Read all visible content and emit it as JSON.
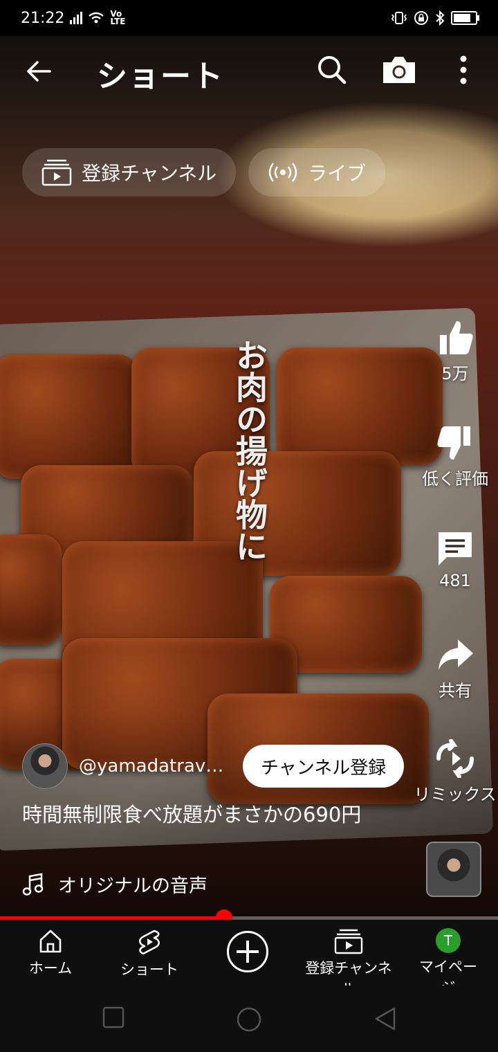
{
  "status_bar": {
    "time": "21:22",
    "network_badge_top": "Vo",
    "network_badge_bottom": "LTE",
    "icons": [
      "signal-icon",
      "wifi-icon",
      "vibrate-icon",
      "lock-rotation-icon",
      "bluetooth-icon",
      "battery-icon"
    ]
  },
  "header": {
    "title": "ショート",
    "icons": [
      "back-arrow-icon",
      "search-icon",
      "camera-icon",
      "more-vert-icon"
    ]
  },
  "chips": [
    {
      "label": "登録チャンネル",
      "icon": "subscriptions-icon"
    },
    {
      "label": "ライブ",
      "icon": "live-icon"
    }
  ],
  "video": {
    "caption_overlay": "お肉の揚げ物に",
    "title": "時間無制限食べ放題がまさかの690円",
    "channel_name": "@yamadatravel...",
    "subscribe_label": "チャンネル登録",
    "audio_label": "オリジナルの音声",
    "progress_fraction": 0.45
  },
  "actions": {
    "like": {
      "label": "5万",
      "icon": "thumb-up-icon"
    },
    "dislike": {
      "label": "低く評価",
      "icon": "thumb-down-icon"
    },
    "comments": {
      "label": "481",
      "icon": "comment-icon"
    },
    "share": {
      "label": "共有",
      "icon": "share-icon"
    },
    "remix": {
      "label": "リミックス",
      "icon": "remix-icon"
    }
  },
  "bottom_nav": {
    "home": "ホーム",
    "shorts": "ショート",
    "subscriptions": "登録チャンネル",
    "me": "マイページ",
    "me_initial": "T"
  },
  "colors": {
    "accent_red": "#ff0000",
    "nav_bg": "#0f0f0f",
    "avatar_green": "#2a9d2a"
  }
}
